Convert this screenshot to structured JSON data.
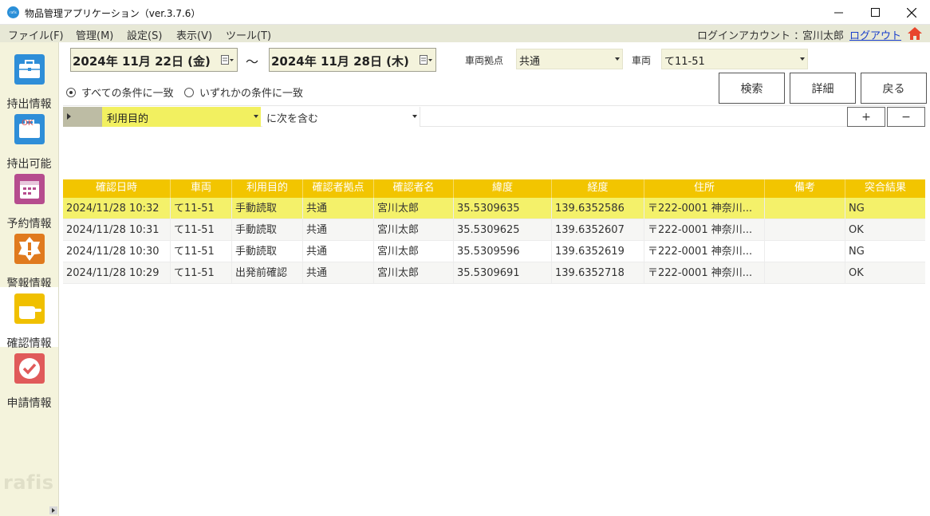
{
  "window": {
    "title": "物品管理アプリケーション（ver.3.7.6）",
    "app_icon_text": "rafis",
    "minimize": "—",
    "maximize": "☐",
    "close": "✕"
  },
  "menu": {
    "items": [
      "ファイル(F)",
      "管理(M)",
      "設定(S)",
      "表示(V)",
      "ツール(T)"
    ],
    "login_label": "ログインアカウント ：",
    "login_user": "宮川太郎",
    "logout": "ログアウト"
  },
  "sidebar": {
    "items": [
      {
        "label": "持出情報",
        "icon": "briefcase-icon",
        "color": "#2e8ed8"
      },
      {
        "label": "持出可能",
        "icon": "briefcase-ok-icon",
        "color": "#2e8ed8",
        "badge": "OK"
      },
      {
        "label": "予約情報",
        "icon": "calendar-icon",
        "color": "#b64c8e"
      },
      {
        "label": "警報情報",
        "icon": "alert-icon",
        "color": "#e07a1e"
      },
      {
        "label": "確認情報",
        "icon": "pointing-hand-icon",
        "color": "#f0c000",
        "active": true
      },
      {
        "label": "申請情報",
        "icon": "check-icon",
        "color": "#e05a5a"
      }
    ],
    "logo": "rafis"
  },
  "search": {
    "date_from": "2024年 11月 22日 (金)",
    "date_to": "2024年 11月 28日 (木)",
    "tilde": "～",
    "base_label": "車両拠点",
    "base_value": "共通",
    "vehicle_label": "車両",
    "vehicle_value": "て11-51",
    "radio_all": "すべての条件に一致",
    "radio_any": "いずれかの条件に一致",
    "radio_selected": "all",
    "buttons": {
      "search": "検索",
      "detail": "詳細",
      "back": "戻る"
    },
    "filter_field": "利用目的",
    "filter_op": "に次を含む",
    "filter_value": "",
    "add": "+",
    "remove": "−"
  },
  "table": {
    "columns": [
      "確認日時",
      "車両",
      "利用目的",
      "確認者拠点",
      "確認者名",
      "緯度",
      "経度",
      "住所",
      "備考",
      "突合結果"
    ],
    "rows": [
      [
        "2024/11/28 10:32",
        "て11-51",
        "手動読取",
        "共通",
        "宮川太郎",
        "35.5309635",
        "139.6352586",
        "〒222-0001 神奈川...",
        "",
        "NG"
      ],
      [
        "2024/11/28 10:31",
        "て11-51",
        "手動読取",
        "共通",
        "宮川太郎",
        "35.5309625",
        "139.6352607",
        "〒222-0001 神奈川...",
        "",
        "OK"
      ],
      [
        "2024/11/28 10:30",
        "て11-51",
        "手動読取",
        "共通",
        "宮川太郎",
        "35.5309596",
        "139.6352619",
        "〒222-0001 神奈川...",
        "",
        "NG"
      ],
      [
        "2024/11/28 10:29",
        "て11-51",
        "出発前確認",
        "共通",
        "宮川太郎",
        "35.5309691",
        "139.6352718",
        "〒222-0001 神奈川...",
        "",
        "OK"
      ]
    ],
    "selected_row": 0
  },
  "colors": {
    "header": "#f2c500",
    "selected_row": "#f4f16a",
    "sidebar_bg": "#f4f3dc",
    "menubar_bg": "#e7e8d6",
    "home_icon": "#e8452c"
  }
}
